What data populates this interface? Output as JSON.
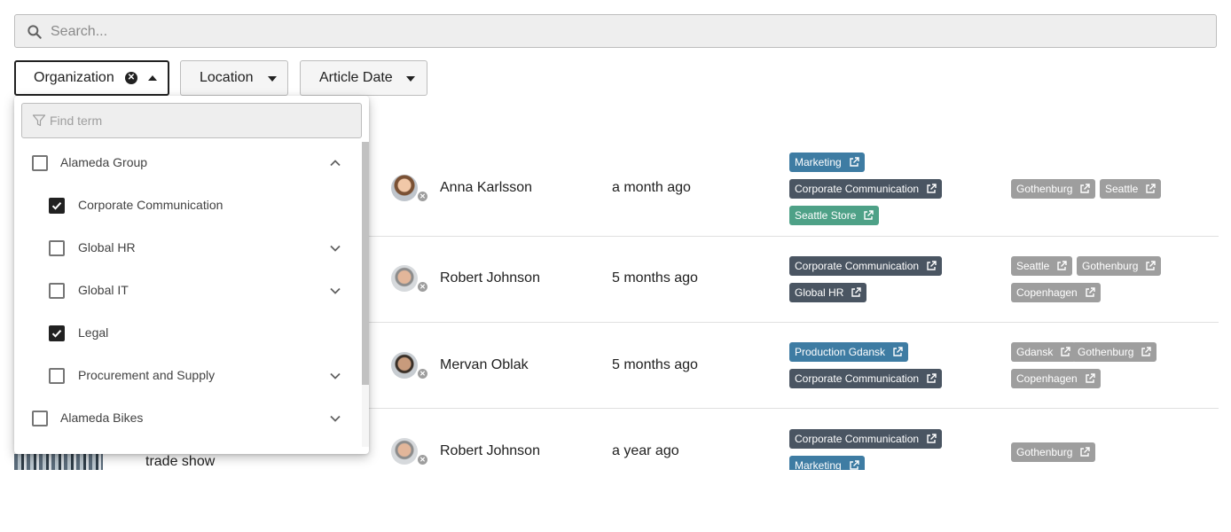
{
  "search": {
    "placeholder": "Search..."
  },
  "filters": [
    {
      "label": "Organization"
    },
    {
      "label": "Location"
    },
    {
      "label": "Article Date"
    }
  ],
  "dropdown": {
    "find_placeholder": "Find term",
    "options": [
      {
        "label": "Alameda Group",
        "checked": false,
        "expanded": true
      },
      {
        "label": "Corporate Communication",
        "checked": true
      },
      {
        "label": "Global HR",
        "checked": false
      },
      {
        "label": "Global IT",
        "checked": false
      },
      {
        "label": "Legal",
        "checked": true
      },
      {
        "label": "Procurement and Supply",
        "checked": false
      },
      {
        "label": "Alameda Bikes",
        "checked": false
      }
    ]
  },
  "rows": [
    {
      "person": "Anna Karlsson",
      "date": "a month ago",
      "org_tags": [
        "Marketing",
        "Corporate Communication",
        "Seattle Store"
      ],
      "loc_tags": [
        "Gothenburg",
        "Seattle"
      ]
    },
    {
      "person": "Robert Johnson",
      "date": "5 months ago",
      "org_tags": [
        "Corporate Communication",
        "Global HR"
      ],
      "loc_tags": [
        "Seattle",
        "Gothenburg",
        "Copenhagen"
      ]
    },
    {
      "person": "Mervan Oblak",
      "date": "5 months ago",
      "org_tags": [
        "Production Gdansk",
        "Corporate Communication"
      ],
      "loc_tags": [
        "Gdansk",
        "Gothenburg",
        "Copenhagen"
      ]
    },
    {
      "person": "Robert Johnson",
      "date": "a year ago",
      "title_fragment": "trade show",
      "org_tags": [
        "Corporate Communication",
        "Marketing"
      ],
      "loc_tags": [
        "Gothenburg"
      ]
    }
  ],
  "colors": {
    "tag_dark": "#4a5562",
    "tag_blue": "#3e7ca3",
    "tag_green": "#4ea187",
    "tag_grey": "#9e9e9e"
  }
}
